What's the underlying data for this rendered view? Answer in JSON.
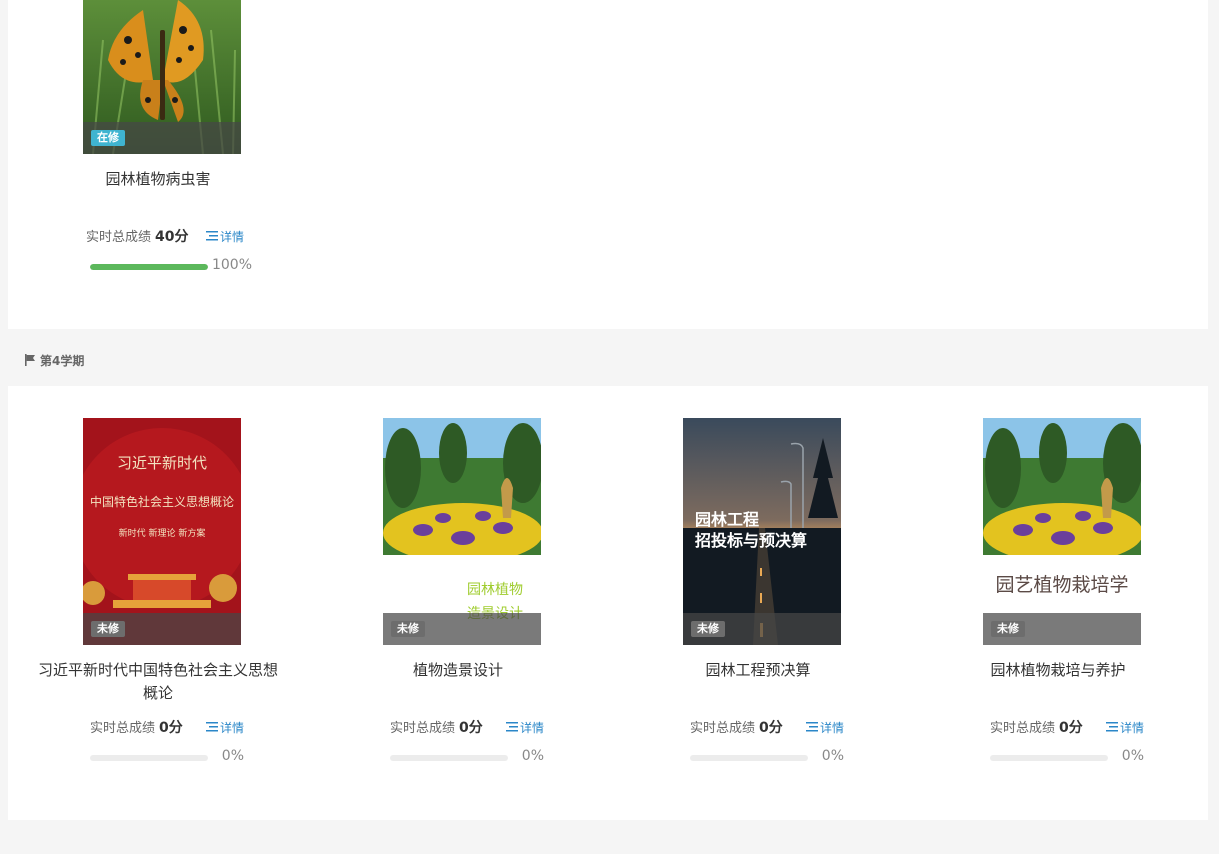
{
  "top_course": {
    "name": "园林植物病虫害",
    "status": "在修",
    "score_label": "实时总成绩",
    "score": "40分",
    "detail": "详情",
    "progress": 1.0,
    "progress_text": "100%"
  },
  "semester": {
    "title": "第4学期",
    "courses": [
      {
        "name": "习近平新时代中国特色社会主义思想概论",
        "status": "未修",
        "score_label": "实时总成绩",
        "score": "0分",
        "detail": "详情",
        "progress": 0,
        "progress_text": "0%",
        "cover_lines": [
          "习近平新时代",
          "中国特色社会主义思想概论",
          "新时代 新理论 新方案"
        ]
      },
      {
        "name": "植物造景设计",
        "status": "未修",
        "score_label": "实时总成绩",
        "score": "0分",
        "detail": "详情",
        "progress": 0,
        "progress_text": "0%",
        "cover_lines": [
          "园林植物",
          "造景设计"
        ]
      },
      {
        "name": "园林工程预决算",
        "status": "未修",
        "score_label": "实时总成绩",
        "score": "0分",
        "detail": "详情",
        "progress": 0,
        "progress_text": "0%",
        "cover_lines": [
          "园林工程",
          "招投标与预决算"
        ]
      },
      {
        "name": "园林植物栽培与养护",
        "status": "未修",
        "score_label": "实时总成绩",
        "score": "0分",
        "detail": "详情",
        "progress": 0,
        "progress_text": "0%",
        "cover_lines": [
          "园艺植物栽培学"
        ]
      }
    ]
  },
  "colors": {
    "status_active": "#3fb4d0",
    "status_inactive": "#6d6d6d",
    "progress": "#5cb85c",
    "link": "#2b87c8"
  }
}
